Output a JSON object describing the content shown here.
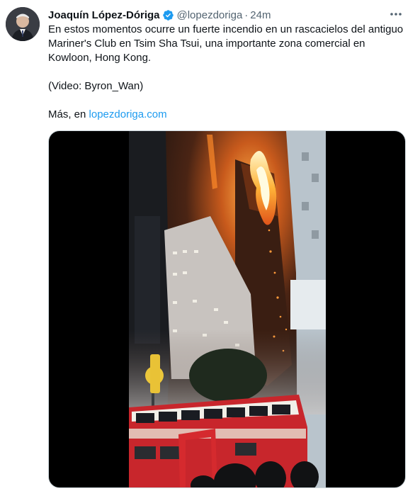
{
  "author": {
    "name": "Joaquín López-Dóriga",
    "handle": "@lopezdoriga",
    "separator": "·",
    "time": "24m",
    "verified_icon": "verified-badge-icon",
    "verified_color": "#1d9bf0"
  },
  "tweet": {
    "paragraph1": "En estos momentos ocurre un fuerte incendio en un rascacielos del antiguo Mariner's Club en Tsim Sha Tsui, una importante zona comercial en Kowloon, Hong Kong.",
    "paragraph2": "(Video: Byron_Wan)",
    "more_prefix": "Más, en ",
    "link_text": "lopezdoriga.com",
    "link_color": "#1d9bf0"
  },
  "media": {
    "type": "video",
    "description_icon": "video-frame"
  },
  "icons": {
    "more": "more-horizontal-icon"
  }
}
